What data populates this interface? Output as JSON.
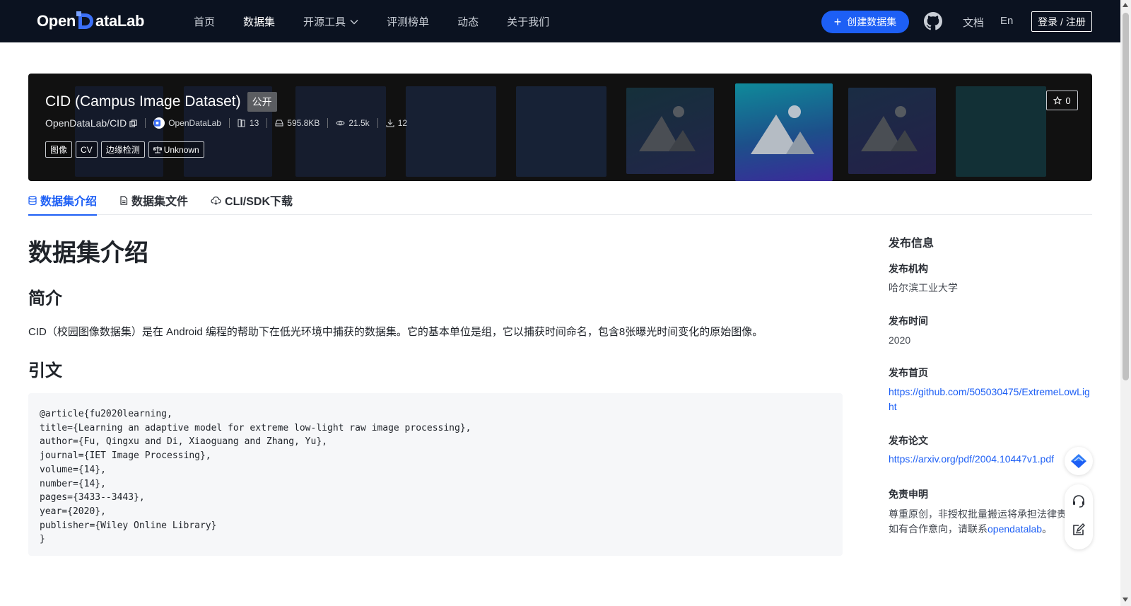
{
  "navbar": {
    "logo_left": "Open",
    "logo_right": "ataLab",
    "items": [
      {
        "label": "首页"
      },
      {
        "label": "数据集",
        "active": true
      },
      {
        "label": "开源工具",
        "dropdown": true
      },
      {
        "label": "评测榜单"
      },
      {
        "label": "动态"
      },
      {
        "label": "关于我们"
      }
    ],
    "create_button": "创建数据集",
    "docs": "文档",
    "lang": "En",
    "login": "登录 / 注册",
    "accent": "#1d5ff5"
  },
  "hero": {
    "title": "CID (Campus Image Dataset)",
    "visibility": "公开",
    "repo": "OpenDataLab/CID",
    "org": "OpenDataLab",
    "file_count": "13",
    "size": "595.8KB",
    "views": "21.5k",
    "downloads": "12",
    "tags": [
      "图像",
      "CV",
      "边缘检测"
    ],
    "license": "Unknown",
    "stars": "0"
  },
  "tabs": [
    {
      "label": "数据集介绍",
      "active": true,
      "icon": "database-icon"
    },
    {
      "label": "数据集文件",
      "icon": "file-icon"
    },
    {
      "label": "CLI/SDK下载",
      "icon": "cloud-download-icon"
    }
  ],
  "content": {
    "heading": "数据集介绍",
    "intro_heading": "简介",
    "intro_text": "CID（校园图像数据集）是在 Android 编程的帮助下在低光环境中捕获的数据集。它的基本单位是组，它以捕获时间命名，包含8张曝光时间变化的原始图像。",
    "citation_heading": "引文",
    "citation_lines": [
      "@article{fu2020learning,",
      "title={Learning an adaptive model for extreme low-light raw image processing},",
      "author={Fu, Qingxu and Di, Xiaoguang and Zhang, Yu},",
      "journal={IET Image Processing},",
      "volume={14},",
      "number={14},",
      "pages={3433--3443},",
      "year={2020},",
      "publisher={Wiley Online Library}",
      "}"
    ]
  },
  "sidebar": {
    "title": "发布信息",
    "org_label": "发布机构",
    "org_value": "哈尔滨工业大学",
    "time_label": "发布时间",
    "time_value": "2020",
    "home_label": "发布首页",
    "home_value": "https://github.com/505030475/ExtremeLowLight",
    "paper_label": "发布论文",
    "paper_value": "https://arxiv.org/pdf/2004.10447v1.pdf",
    "disclaimer_label": "免责申明",
    "disclaimer_line1": "尊重原创，非授权批量搬运将承担法律责任",
    "disclaimer_line2_prefix": "如有合作意向，请联系",
    "disclaimer_link": "opendatalab",
    "disclaimer_suffix": "。"
  }
}
